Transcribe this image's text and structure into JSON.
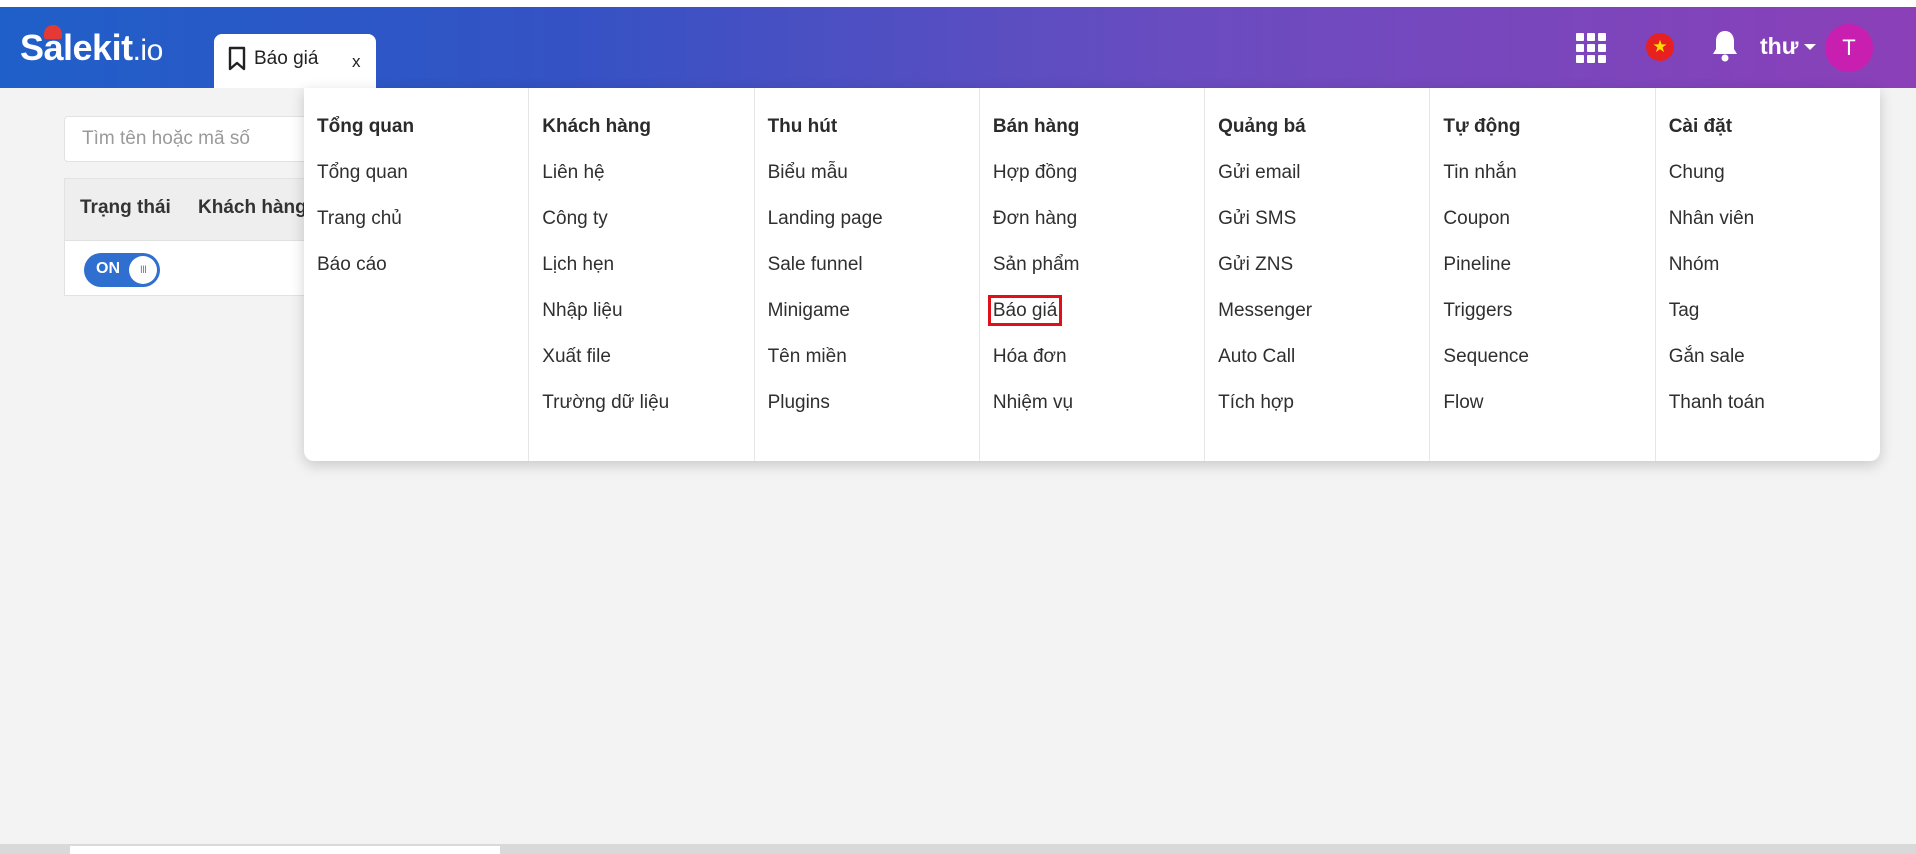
{
  "brand": {
    "name": "Salekit",
    "suffix": ".io"
  },
  "tab": {
    "label": "Báo giá",
    "close": "x"
  },
  "header": {
    "user_name": "thư",
    "avatar_letter": "T",
    "flag_glyph": "★"
  },
  "search": {
    "placeholder": "Tìm tên hoặc mã số"
  },
  "table": {
    "columns": [
      "Trạng thái",
      "Khách hàng"
    ],
    "toggle_label": "ON",
    "toggle_knob": "III"
  },
  "menu": {
    "columns": [
      {
        "title": "Tổng quan",
        "items": [
          "Tổng quan",
          "Trang chủ",
          "Báo cáo"
        ]
      },
      {
        "title": "Khách hàng",
        "items": [
          "Liên hệ",
          "Công ty",
          "Lịch hẹn",
          "Nhập liệu",
          "Xuất file",
          "Trường dữ liệu"
        ]
      },
      {
        "title": "Thu hút",
        "items": [
          "Biểu mẫu",
          "Landing page",
          "Sale funnel",
          "Minigame",
          "Tên miền",
          "Plugins"
        ]
      },
      {
        "title": "Bán hàng",
        "items": [
          "Hợp đồng",
          "Đơn hàng",
          "Sản phẩm",
          "Báo giá",
          "Hóa đơn",
          "Nhiệm vụ"
        ]
      },
      {
        "title": "Quảng bá",
        "items": [
          "Gửi email",
          "Gửi SMS",
          "Gửi ZNS",
          "Messenger",
          "Auto Call",
          "Tích hợp"
        ]
      },
      {
        "title": "Tự động",
        "items": [
          "Tin nhắn",
          "Coupon",
          "Pineline",
          "Triggers",
          "Sequence",
          "Flow"
        ]
      },
      {
        "title": "Cài đặt",
        "items": [
          "Chung",
          "Nhân viên",
          "Nhóm",
          "Tag",
          "Gắn sale",
          "Thanh toán"
        ]
      }
    ]
  },
  "colors": {
    "header_start": "#1f5fc9",
    "header_end": "#8b40b8",
    "highlight": "#e0101a",
    "toggle_on": "#2f6fd0",
    "avatar": "#c81fb0"
  }
}
